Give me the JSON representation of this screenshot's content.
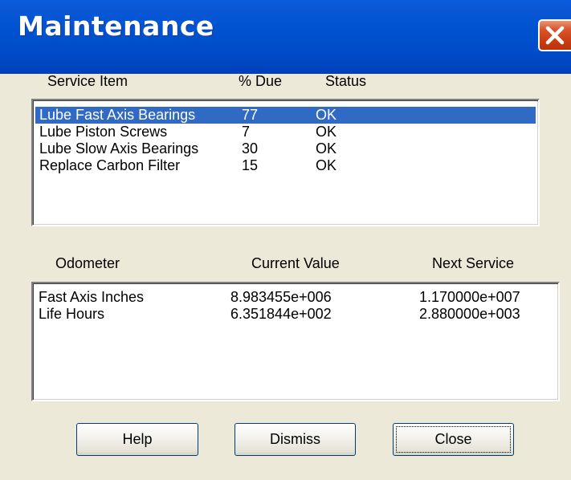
{
  "window": {
    "title": "Maintenance",
    "close_icon": "close-x-icon"
  },
  "service": {
    "headers": {
      "item": "Service Item",
      "due": "% Due",
      "status": "Status"
    },
    "rows": [
      {
        "item": "Lube Fast Axis Bearings",
        "due": "77",
        "status": "OK",
        "selected": true
      },
      {
        "item": "Lube Piston Screws",
        "due": "7",
        "status": "OK",
        "selected": false
      },
      {
        "item": "Lube Slow Axis Bearings",
        "due": "30",
        "status": "OK",
        "selected": false
      },
      {
        "item": "Replace Carbon Filter",
        "due": "15",
        "status": "OK",
        "selected": false
      }
    ]
  },
  "odometer": {
    "headers": {
      "name": "Odometer",
      "current": "Current Value",
      "next": "Next Service"
    },
    "rows": [
      {
        "name": "Fast Axis Inches",
        "current": "8.983455e+006",
        "next": "1.170000e+007"
      },
      {
        "name": "Life Hours",
        "current": "6.351844e+002",
        "next": "2.880000e+003"
      }
    ]
  },
  "buttons": {
    "help": "Help",
    "dismiss": "Dismiss",
    "close": "Close"
  },
  "colors": {
    "titlebar": "#0052d0",
    "selection": "#316ac5",
    "close_button": "#d9542c"
  }
}
